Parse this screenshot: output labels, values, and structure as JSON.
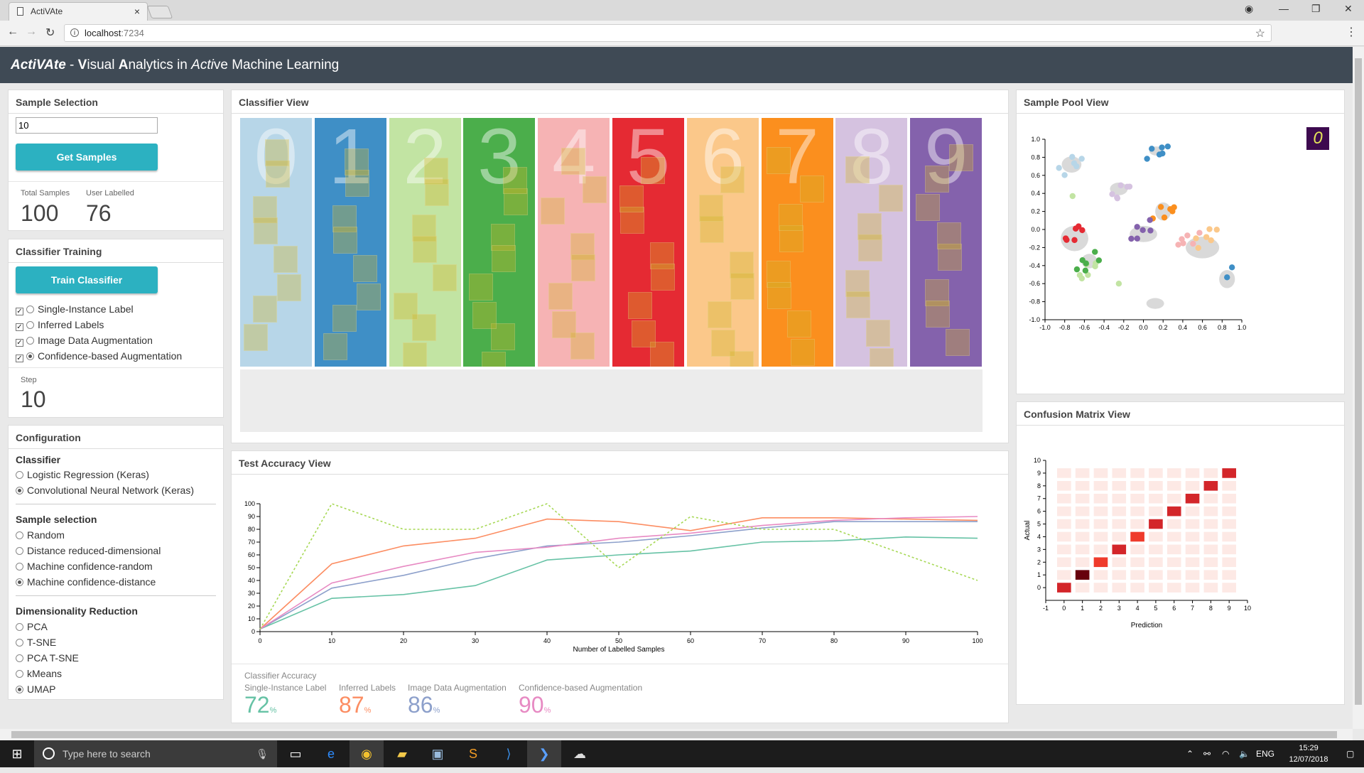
{
  "browser": {
    "tab_title": "ActiVAte",
    "url_host": "localhost",
    "url_port": ":7234"
  },
  "header": {
    "title_parts": [
      "ActiVAte",
      " - ",
      "V",
      "isual ",
      "A",
      "nalytics in ",
      "Acti",
      "ve Machine Learning"
    ]
  },
  "sample_selection": {
    "title": "Sample Selection",
    "count_value": "10",
    "button": "Get Samples",
    "total_label": "Total Samples",
    "total_value": "100",
    "user_label": "User Labelled",
    "user_value": "76"
  },
  "classifier_training": {
    "title": "Classifier Training",
    "button": "Train Classifier",
    "options": [
      {
        "label": "Single-Instance Label",
        "checked": true,
        "radio": false
      },
      {
        "label": "Inferred Labels",
        "checked": true,
        "radio": false
      },
      {
        "label": "Image Data Augmentation",
        "checked": true,
        "radio": false
      },
      {
        "label": "Confidence-based Augmentation",
        "checked": true,
        "radio": true
      }
    ],
    "step_label": "Step",
    "step_value": "10"
  },
  "configuration": {
    "title": "Configuration",
    "classifier_heading": "Classifier",
    "classifiers": [
      {
        "label": "Logistic Regression (Keras)",
        "selected": false
      },
      {
        "label": "Convolutional Neural Network (Keras)",
        "selected": true
      }
    ],
    "sampling_heading": "Sample selection",
    "sampling": [
      {
        "label": "Random",
        "selected": false
      },
      {
        "label": "Distance reduced-dimensional",
        "selected": false
      },
      {
        "label": "Machine confidence-random",
        "selected": false
      },
      {
        "label": "Machine confidence-distance",
        "selected": true
      }
    ],
    "dimred_heading": "Dimensionality Reduction",
    "dimred": [
      {
        "label": "PCA",
        "selected": false
      },
      {
        "label": "T-SNE",
        "selected": false
      },
      {
        "label": "PCA T-SNE",
        "selected": false
      },
      {
        "label": "kMeans",
        "selected": false
      },
      {
        "label": "UMAP",
        "selected": true
      }
    ]
  },
  "classifier_view": {
    "title": "Classifier View",
    "classes": [
      {
        "digit": "0",
        "color": "#b7d6e8"
      },
      {
        "digit": "1",
        "color": "#3f8fc6"
      },
      {
        "digit": "2",
        "color": "#c2e4a3"
      },
      {
        "digit": "3",
        "color": "#4bae4b"
      },
      {
        "digit": "4",
        "color": "#f6b3b4"
      },
      {
        "digit": "5",
        "color": "#e52a33"
      },
      {
        "digit": "6",
        "color": "#fbc88a"
      },
      {
        "digit": "7",
        "color": "#fb8f1e"
      },
      {
        "digit": "8",
        "color": "#d5c2e0"
      },
      {
        "digit": "9",
        "color": "#8462ac"
      }
    ]
  },
  "sample_pool": {
    "title": "Sample Pool View",
    "preview_digit": "0",
    "x_ticks": [
      "-1.0",
      "-0.8",
      "-0.6",
      "-0.4",
      "-0.2",
      "0.0",
      "0.2",
      "0.4",
      "0.6",
      "0.8",
      "1.0"
    ],
    "y_ticks": [
      "1.0",
      "0.8",
      "0.6",
      "0.4",
      "0.2",
      "0.0",
      "-0.2",
      "-0.4",
      "-0.6",
      "-0.8",
      "-1.0"
    ]
  },
  "confusion": {
    "title": "Confusion Matrix View",
    "xlabel": "Prediction",
    "ylabel": "Actual",
    "ticks": [
      "-1",
      "0",
      "1",
      "2",
      "3",
      "4",
      "5",
      "6",
      "7",
      "8",
      "9",
      "10"
    ]
  },
  "test_accuracy": {
    "title": "Test Accuracy View",
    "xlabel": "Number of Labelled Samples",
    "section_label": "Classifier Accuracy",
    "summary": [
      {
        "label": "Single-Instance Label",
        "value": "72",
        "unit": "%",
        "color": "#66c2a5"
      },
      {
        "label": "Inferred Labels",
        "value": "87",
        "unit": "%",
        "color": "#fc8d62"
      },
      {
        "label": "Image Data Augmentation",
        "value": "86",
        "unit": "%",
        "color": "#8da0cb"
      },
      {
        "label": "Confidence-based Augmentation",
        "value": "90",
        "unit": "%",
        "color": "#e78ac3"
      }
    ]
  },
  "chart_data": {
    "type": "line",
    "x": [
      0,
      10,
      20,
      30,
      40,
      50,
      60,
      70,
      80,
      90,
      100
    ],
    "xlim": [
      0,
      100
    ],
    "ylim": [
      0,
      100
    ],
    "xlabel": "Number of Labelled Samples",
    "ylabel": "",
    "x_ticks": [
      0,
      10,
      20,
      30,
      40,
      50,
      60,
      70,
      80,
      90,
      100
    ],
    "y_ticks": [
      0,
      10,
      20,
      30,
      40,
      50,
      60,
      70,
      80,
      90,
      100
    ],
    "series": [
      {
        "color": "#66c2a5",
        "dash": false,
        "values": [
          2,
          26,
          29,
          36,
          56,
          60,
          63,
          70,
          71,
          74,
          73
        ]
      },
      {
        "color": "#fc8d62",
        "dash": false,
        "values": [
          2,
          53,
          67,
          73,
          88,
          86,
          79,
          89,
          89,
          88,
          87
        ]
      },
      {
        "color": "#8da0cb",
        "dash": false,
        "values": [
          2,
          34,
          44,
          57,
          67,
          70,
          75,
          81,
          86,
          86,
          86
        ]
      },
      {
        "color": "#e78ac3",
        "dash": false,
        "values": [
          2,
          38,
          51,
          62,
          66,
          73,
          77,
          83,
          87,
          89,
          90
        ]
      },
      {
        "color": "#a6d854",
        "dash": true,
        "values": [
          2,
          100,
          80,
          80,
          100,
          50,
          90,
          80,
          80,
          60,
          40
        ]
      }
    ]
  },
  "taskbar": {
    "search_placeholder": "Type here to search",
    "lang": "ENG",
    "time": "15:29",
    "date": "12/07/2018"
  }
}
